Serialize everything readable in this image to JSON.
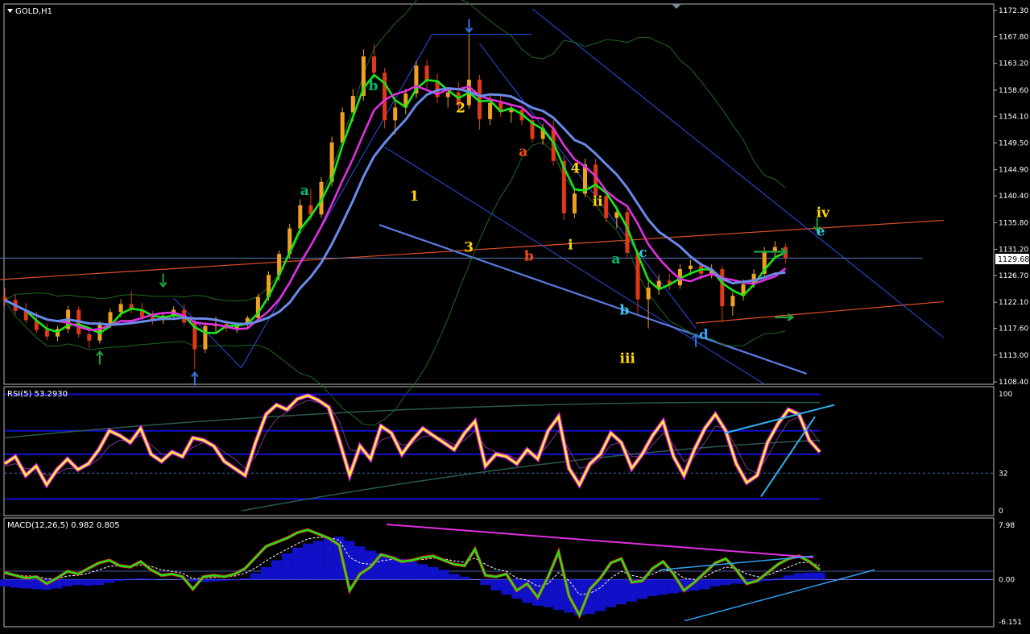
{
  "chart_data": [
    {
      "type": "line",
      "title": "GOLD,H1",
      "symbol": "GOLD",
      "timeframe": "H1",
      "current_price": "1129.68",
      "y_ticks": [
        "1172.30",
        "1167.80",
        "1163.20",
        "1158.60",
        "1154.10",
        "1149.50",
        "1144.90",
        "1140.40",
        "1135.80",
        "1131.20",
        "1126.70",
        "1122.10",
        "1117.60",
        "1113.00",
        "1108.40"
      ],
      "ylim": [
        1108.4,
        1172.3
      ],
      "candles": [
        {
          "o": 1123.0,
          "h": 1124.5,
          "l": 1121.5,
          "c": 1122.5
        },
        {
          "o": 1122.5,
          "h": 1123.5,
          "l": 1120.0,
          "c": 1120.6
        },
        {
          "o": 1120.6,
          "h": 1122.0,
          "l": 1118.5,
          "c": 1119.0
        },
        {
          "o": 1119.0,
          "h": 1120.5,
          "l": 1116.8,
          "c": 1117.3
        },
        {
          "o": 1117.3,
          "h": 1118.4,
          "l": 1115.6,
          "c": 1116.2
        },
        {
          "o": 1116.2,
          "h": 1118.0,
          "l": 1115.4,
          "c": 1117.5
        },
        {
          "o": 1117.5,
          "h": 1121.5,
          "l": 1116.8,
          "c": 1120.8
        },
        {
          "o": 1120.8,
          "h": 1121.4,
          "l": 1116.0,
          "c": 1116.6
        },
        {
          "o": 1116.6,
          "h": 1117.2,
          "l": 1114.2,
          "c": 1115.5
        },
        {
          "o": 1115.5,
          "h": 1118.8,
          "l": 1115.0,
          "c": 1118.2
        },
        {
          "o": 1118.2,
          "h": 1121.0,
          "l": 1117.6,
          "c": 1120.4
        },
        {
          "o": 1120.4,
          "h": 1122.6,
          "l": 1119.5,
          "c": 1121.8
        },
        {
          "o": 1121.8,
          "h": 1124.0,
          "l": 1120.2,
          "c": 1120.8
        },
        {
          "o": 1120.8,
          "h": 1122.0,
          "l": 1119.0,
          "c": 1119.6
        },
        {
          "o": 1119.6,
          "h": 1120.6,
          "l": 1118.2,
          "c": 1119.0
        },
        {
          "o": 1119.0,
          "h": 1120.2,
          "l": 1118.4,
          "c": 1119.8
        },
        {
          "o": 1119.8,
          "h": 1121.4,
          "l": 1119.2,
          "c": 1120.8
        },
        {
          "o": 1120.8,
          "h": 1121.8,
          "l": 1118.0,
          "c": 1118.6
        },
        {
          "o": 1118.6,
          "h": 1119.2,
          "l": 1110.6,
          "c": 1114.0
        },
        {
          "o": 1114.0,
          "h": 1118.6,
          "l": 1113.4,
          "c": 1118.0
        },
        {
          "o": 1118.0,
          "h": 1119.6,
          "l": 1117.0,
          "c": 1118.4
        },
        {
          "o": 1118.4,
          "h": 1119.0,
          "l": 1117.0,
          "c": 1117.6
        },
        {
          "o": 1117.6,
          "h": 1118.6,
          "l": 1116.8,
          "c": 1118.2
        },
        {
          "o": 1118.2,
          "h": 1119.8,
          "l": 1117.6,
          "c": 1119.4
        },
        {
          "o": 1119.4,
          "h": 1123.6,
          "l": 1119.0,
          "c": 1123.0
        },
        {
          "o": 1123.0,
          "h": 1127.4,
          "l": 1122.4,
          "c": 1126.8
        },
        {
          "o": 1126.8,
          "h": 1131.0,
          "l": 1125.8,
          "c": 1130.4
        },
        {
          "o": 1130.4,
          "h": 1135.6,
          "l": 1129.6,
          "c": 1134.8
        },
        {
          "o": 1134.8,
          "h": 1139.8,
          "l": 1134.0,
          "c": 1138.8
        },
        {
          "o": 1138.8,
          "h": 1141.6,
          "l": 1136.2,
          "c": 1137.2
        },
        {
          "o": 1137.2,
          "h": 1143.6,
          "l": 1136.6,
          "c": 1142.8
        },
        {
          "o": 1142.8,
          "h": 1150.6,
          "l": 1142.0,
          "c": 1149.6
        },
        {
          "o": 1149.6,
          "h": 1155.6,
          "l": 1148.8,
          "c": 1154.8
        },
        {
          "o": 1154.8,
          "h": 1158.8,
          "l": 1153.2,
          "c": 1157.6
        },
        {
          "o": 1157.6,
          "h": 1165.6,
          "l": 1156.8,
          "c": 1164.4
        },
        {
          "o": 1164.4,
          "h": 1166.6,
          "l": 1160.6,
          "c": 1161.6
        },
        {
          "o": 1161.6,
          "h": 1162.4,
          "l": 1152.0,
          "c": 1153.4
        },
        {
          "o": 1153.4,
          "h": 1156.6,
          "l": 1151.0,
          "c": 1155.6
        },
        {
          "o": 1155.6,
          "h": 1158.8,
          "l": 1154.4,
          "c": 1158.0
        },
        {
          "o": 1158.0,
          "h": 1163.6,
          "l": 1157.2,
          "c": 1162.8
        },
        {
          "o": 1162.8,
          "h": 1163.8,
          "l": 1158.8,
          "c": 1160.2
        },
        {
          "o": 1160.2,
          "h": 1161.4,
          "l": 1156.4,
          "c": 1157.4
        },
        {
          "o": 1157.4,
          "h": 1158.8,
          "l": 1155.6,
          "c": 1158.2
        },
        {
          "o": 1158.2,
          "h": 1160.0,
          "l": 1155.0,
          "c": 1156.0
        },
        {
          "o": 1156.0,
          "h": 1168.2,
          "l": 1155.4,
          "c": 1160.4
        },
        {
          "o": 1160.4,
          "h": 1161.2,
          "l": 1151.8,
          "c": 1153.6
        },
        {
          "o": 1153.6,
          "h": 1157.6,
          "l": 1152.6,
          "c": 1156.4
        },
        {
          "o": 1156.4,
          "h": 1157.6,
          "l": 1154.0,
          "c": 1154.8
        },
        {
          "o": 1154.8,
          "h": 1156.0,
          "l": 1153.0,
          "c": 1155.2
        },
        {
          "o": 1155.2,
          "h": 1155.8,
          "l": 1152.6,
          "c": 1153.4
        },
        {
          "o": 1153.4,
          "h": 1154.0,
          "l": 1149.6,
          "c": 1150.2
        },
        {
          "o": 1150.2,
          "h": 1152.8,
          "l": 1149.2,
          "c": 1152.0
        },
        {
          "o": 1152.0,
          "h": 1153.4,
          "l": 1145.6,
          "c": 1146.4
        },
        {
          "o": 1146.4,
          "h": 1147.2,
          "l": 1136.2,
          "c": 1137.4
        },
        {
          "o": 1137.4,
          "h": 1141.8,
          "l": 1136.6,
          "c": 1140.8
        },
        {
          "o": 1140.8,
          "h": 1146.8,
          "l": 1140.2,
          "c": 1145.8
        },
        {
          "o": 1145.8,
          "h": 1146.8,
          "l": 1139.6,
          "c": 1140.4
        },
        {
          "o": 1140.4,
          "h": 1141.4,
          "l": 1135.8,
          "c": 1136.6
        },
        {
          "o": 1136.6,
          "h": 1138.6,
          "l": 1134.8,
          "c": 1137.6
        },
        {
          "o": 1137.6,
          "h": 1138.2,
          "l": 1129.8,
          "c": 1130.6
        },
        {
          "o": 1130.6,
          "h": 1131.2,
          "l": 1120.2,
          "c": 1122.6
        },
        {
          "o": 1122.6,
          "h": 1125.6,
          "l": 1117.6,
          "c": 1124.6
        },
        {
          "o": 1124.6,
          "h": 1126.8,
          "l": 1123.4,
          "c": 1125.8
        },
        {
          "o": 1125.8,
          "h": 1127.0,
          "l": 1124.2,
          "c": 1125.0
        },
        {
          "o": 1125.0,
          "h": 1128.6,
          "l": 1124.4,
          "c": 1127.8
        },
        {
          "o": 1127.8,
          "h": 1129.4,
          "l": 1126.8,
          "c": 1128.4
        },
        {
          "o": 1128.4,
          "h": 1129.0,
          "l": 1126.0,
          "c": 1127.0
        },
        {
          "o": 1127.0,
          "h": 1128.6,
          "l": 1126.2,
          "c": 1127.8
        },
        {
          "o": 1127.8,
          "h": 1128.4,
          "l": 1118.6,
          "c": 1121.4
        },
        {
          "o": 1121.4,
          "h": 1123.8,
          "l": 1119.8,
          "c": 1123.2
        },
        {
          "o": 1123.2,
          "h": 1126.0,
          "l": 1122.4,
          "c": 1125.2
        },
        {
          "o": 1125.2,
          "h": 1127.8,
          "l": 1124.6,
          "c": 1127.0
        },
        {
          "o": 1127.0,
          "h": 1131.6,
          "l": 1126.4,
          "c": 1130.8
        },
        {
          "o": 1130.8,
          "h": 1132.6,
          "l": 1129.6,
          "c": 1131.6
        },
        {
          "o": 1131.6,
          "h": 1132.2,
          "l": 1128.8,
          "c": 1129.7
        }
      ],
      "wave_labels": [
        {
          "text": "a",
          "x": 11,
          "y": 1141.4,
          "color": "#00c070"
        },
        {
          "text": "b",
          "x": 13.5,
          "y": 1159.4,
          "color": "#00c070"
        },
        {
          "text": "2",
          "x": 16.7,
          "y": 1155.6,
          "color": "#ffd800"
        },
        {
          "text": "1",
          "x": 15,
          "y": 1140.4,
          "color": "#ffd800"
        },
        {
          "text": "3",
          "x": 17,
          "y": 1131.6,
          "color": "#ffd800"
        },
        {
          "text": "a",
          "x": 19,
          "y": 1148.1,
          "color": "#ff4a18"
        },
        {
          "text": "4",
          "x": 20.9,
          "y": 1145.2,
          "color": "#ffd800"
        },
        {
          "text": "ii",
          "x": 21.7,
          "y": 1139.5,
          "color": "#ffd800"
        },
        {
          "text": "i",
          "x": 20.8,
          "y": 1132.0,
          "color": "#ffd800"
        },
        {
          "text": "b",
          "x": 19.2,
          "y": 1130.1,
          "color": "#ff4a18"
        },
        {
          "text": "a",
          "x": 22.4,
          "y": 1129.6,
          "color": "#00c070"
        },
        {
          "text": "c",
          "x": 23.4,
          "y": 1130.7,
          "color": "#38c8e8"
        },
        {
          "text": "b",
          "x": 22.7,
          "y": 1120.8,
          "color": "#38c8e8"
        },
        {
          "text": "d",
          "x": 25.6,
          "y": 1116.6,
          "color": "#3aa0ff"
        },
        {
          "text": "iii",
          "x": 22.7,
          "y": 1112.5,
          "color": "#ffd800"
        },
        {
          "text": "iv",
          "x": 29.9,
          "y": 1137.6,
          "color": "#ffd800"
        },
        {
          "text": "e",
          "x": 29.9,
          "y": 1134.4,
          "color": "#38c8e8"
        }
      ]
    },
    {
      "type": "line",
      "title": "RSI(5) 53.2930",
      "indicator": "RSI",
      "period": "5",
      "value": "53.2930",
      "y_ticks": [
        "100",
        "32",
        "0"
      ],
      "levels": {
        "high": 68,
        "mid": 48,
        "low": 10
      },
      "values": [
        40,
        46,
        30,
        38,
        22,
        35,
        44,
        35,
        40,
        52,
        68,
        64,
        58,
        70,
        48,
        42,
        50,
        46,
        62,
        60,
        55,
        42,
        36,
        30,
        58,
        82,
        90,
        86,
        95,
        98,
        94,
        88,
        60,
        30,
        55,
        44,
        72,
        66,
        48,
        60,
        70,
        64,
        58,
        52,
        66,
        76,
        38,
        48,
        46,
        40,
        52,
        44,
        68,
        80,
        36,
        22,
        40,
        48,
        66,
        58,
        36,
        48,
        64,
        76,
        46,
        30,
        52,
        70,
        82,
        68,
        40,
        24,
        30,
        58,
        74,
        86,
        82,
        60,
        50
      ],
      "signal": [
        38,
        40,
        36,
        35,
        30,
        32,
        36,
        36,
        38,
        44,
        55,
        60,
        59,
        64,
        56,
        48,
        48,
        47,
        54,
        58,
        56,
        50,
        44,
        36,
        46,
        66,
        78,
        84,
        90,
        94,
        92,
        90,
        76,
        52,
        50,
        47,
        60,
        63,
        56,
        57,
        63,
        64,
        61,
        56,
        60,
        68,
        54,
        50,
        48,
        44,
        48,
        46,
        56,
        68,
        52,
        36,
        38,
        44,
        56,
        58,
        46,
        46,
        56,
        66,
        56,
        42,
        46,
        58,
        72,
        70,
        54,
        36,
        32,
        46,
        62,
        76,
        80,
        70,
        58
      ]
    },
    {
      "type": "bar",
      "title": "MACD(12,26,5) 0.982 0.805",
      "indicator": "MACD",
      "params": "12,26,5",
      "macd_value": "0.982",
      "signal_value": "0.805",
      "y_ticks": [
        "7.98",
        "0.00",
        "-6.151"
      ],
      "ylim": [
        -6.151,
        7.98
      ],
      "histogram": [
        -1.0,
        -1.2,
        -1.3,
        -1.4,
        -1.5,
        -1.3,
        -1.0,
        -0.8,
        -0.9,
        -0.8,
        -0.5,
        -0.2,
        0.1,
        0.2,
        0.1,
        0.0,
        0.0,
        0.1,
        -0.3,
        -0.4,
        -0.3,
        -0.2,
        -0.1,
        0.2,
        0.9,
        1.8,
        2.8,
        3.8,
        4.6,
        5.2,
        5.6,
        6.0,
        6.2,
        5.6,
        4.8,
        4.2,
        3.8,
        3.4,
        3.0,
        2.6,
        2.2,
        1.8,
        1.4,
        0.8,
        0.4,
        0.0,
        -0.8,
        -1.6,
        -2.2,
        -2.8,
        -3.4,
        -3.8,
        -4.0,
        -4.4,
        -4.8,
        -5.2,
        -5.0,
        -4.6,
        -4.0,
        -3.6,
        -3.2,
        -2.8,
        -2.4,
        -2.2,
        -2.0,
        -1.8,
        -1.6,
        -1.4,
        -1.0,
        -0.8,
        -0.6,
        -0.6,
        -0.4,
        -0.2,
        0.2,
        0.6,
        0.9,
        1.0,
        1.0
      ],
      "macd": [
        1.0,
        0.6,
        0.2,
        0.4,
        -0.6,
        0.2,
        1.2,
        0.8,
        1.6,
        2.4,
        2.8,
        2.0,
        1.8,
        2.6,
        1.4,
        0.6,
        0.8,
        0.4,
        -1.4,
        0.4,
        0.6,
        0.4,
        0.8,
        1.6,
        3.2,
        4.8,
        5.4,
        6.0,
        6.8,
        7.2,
        6.6,
        6.0,
        5.0,
        -1.6,
        0.8,
        1.8,
        3.6,
        3.2,
        2.6,
        2.8,
        3.2,
        3.4,
        2.8,
        2.2,
        2.0,
        4.4,
        0.6,
        0.4,
        0.8,
        -1.6,
        -0.6,
        -2.6,
        0.4,
        4.0,
        -2.4,
        -5.2,
        -1.4,
        0.2,
        2.4,
        3.0,
        -0.4,
        -0.2,
        1.6,
        2.6,
        0.8,
        -1.6,
        -0.4,
        1.0,
        2.4,
        3.0,
        1.4,
        -0.6,
        -0.2,
        1.0,
        2.2,
        3.0,
        3.4,
        2.6,
        1.4
      ],
      "signal": [
        0.8,
        0.7,
        0.5,
        0.5,
        0.1,
        0.1,
        0.5,
        0.6,
        0.9,
        1.4,
        1.9,
        2.0,
        1.9,
        2.1,
        1.9,
        1.4,
        1.2,
        0.9,
        0.1,
        0.2,
        0.3,
        0.3,
        0.5,
        0.9,
        1.7,
        2.7,
        3.6,
        4.4,
        5.2,
        5.9,
        6.1,
        6.1,
        5.7,
        3.2,
        2.4,
        2.2,
        2.7,
        2.9,
        2.8,
        2.8,
        2.9,
        3.1,
        3.0,
        2.7,
        2.5,
        3.1,
        2.2,
        1.5,
        1.2,
        0.2,
        -0.1,
        -1.0,
        -0.6,
        1.0,
        -0.2,
        -2.2,
        -2.0,
        -1.2,
        0.2,
        1.2,
        0.6,
        0.3,
        0.8,
        1.4,
        1.2,
        0.2,
        0.0,
        0.4,
        1.2,
        1.8,
        1.6,
        0.8,
        0.4,
        0.6,
        1.2,
        1.8,
        2.4,
        2.5,
        2.0
      ]
    }
  ]
}
